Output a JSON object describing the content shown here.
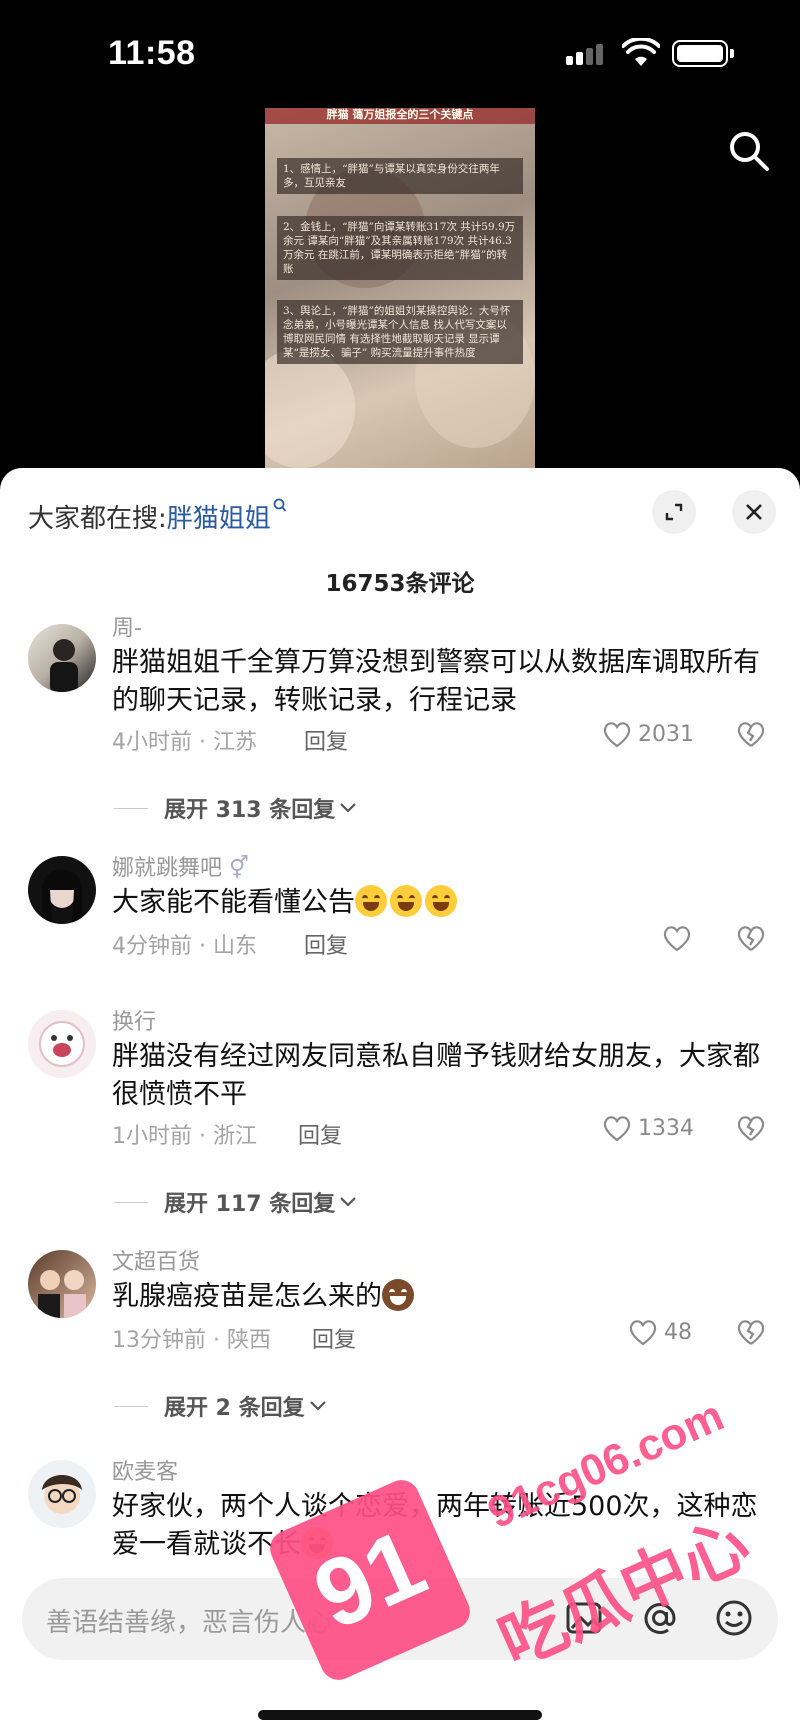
{
  "status_bar": {
    "time": "11:58"
  },
  "video": {
    "title": "胖猫 蔼万姐报全的三个关键点",
    "lines": [
      "1、感情上，“胖猫”与谭某以真实身份交往两年多，互见亲友",
      "2、金钱上，“胖猫”向谭某转账317次 共计59.9万余元 谭某向“胖猫”及其亲属转账179次 共计46.3万余元 在跳江前，谭某明确表示拒绝“胖猫”的转账",
      "3、舆论上，“胖猫”的姐姐刘某操控舆论：大号怀念弟弟，小号曝光谭某个人信息 找人代写文案以博取网民同情 有选择性地截取聊天记录 显示谭某“是捞女、骗子” 购买流量提升事件热度"
    ]
  },
  "sheet": {
    "hot_search_prefix": "大家都在搜:",
    "hot_search_keyword": "胖猫姐姐",
    "comment_count": "16753条评论",
    "comments": [
      {
        "name": "周-",
        "text": "胖猫姐姐千全算万算没想到警察可以从数据库调取所有的聊天记录，转账记录，行程记录",
        "meta": "4小时前 · 江苏",
        "reply": "回复",
        "likes": "2031",
        "expand": "展开 313 条回复"
      },
      {
        "name": "娜就跳舞吧",
        "text": "大家能不能看懂公告",
        "meta": "4分钟前 · 山东",
        "reply": "回复",
        "likes": "",
        "expand": ""
      },
      {
        "name": "换行",
        "text": "胖猫没有经过网友同意私自赠予钱财给女朋友，大家都很愤愤不平",
        "meta": "1小时前 · 浙江",
        "reply": "回复",
        "likes": "1334",
        "expand": "展开 117 条回复"
      },
      {
        "name": "文超百货",
        "text": "乳腺癌疫苗是怎么来的",
        "meta": "13分钟前 · 陕西",
        "reply": "回复",
        "likes": "48",
        "expand": "展开 2 条回复"
      },
      {
        "name": "欧麦客",
        "text": "好家伙，两个人谈个恋爱，两年转账近500次，这种恋爱一看就谈不长",
        "meta": "",
        "reply": "",
        "likes": "",
        "expand": ""
      }
    ]
  },
  "input": {
    "placeholder": "善语结善缘，恶言伤人心"
  },
  "watermark": {
    "badge": "91",
    "site": "91cg06.com",
    "name": "吃瓜中心"
  },
  "colors": {
    "keyword": "#2b5aa5",
    "watermark": "#ff4f86"
  }
}
